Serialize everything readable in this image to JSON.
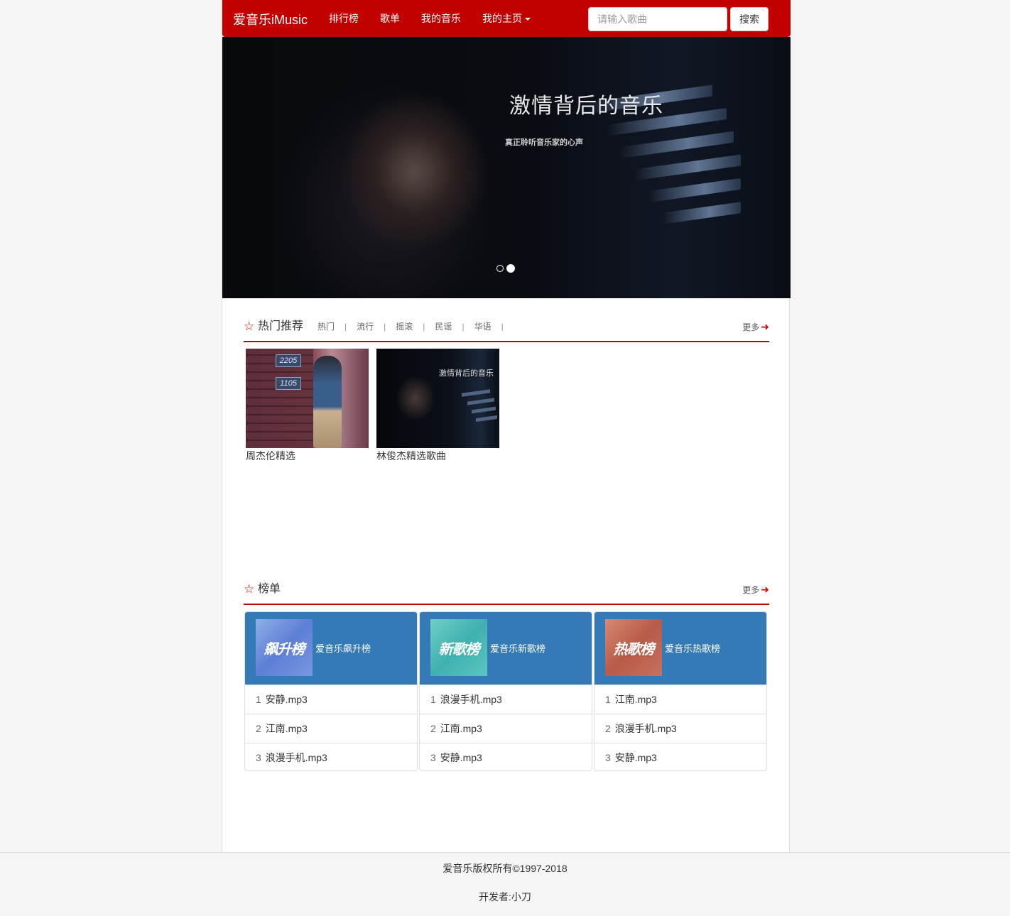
{
  "navbar": {
    "brand": "爱音乐iMusic",
    "items": [
      {
        "label": "排行榜"
      },
      {
        "label": "歌单"
      },
      {
        "label": "我的音乐"
      },
      {
        "label": "我的主页"
      }
    ],
    "search_placeholder": "请输入歌曲",
    "search_button": "搜索",
    "accent_color": "#c20000"
  },
  "banner": {
    "title": "激情背后的音乐",
    "subtitle": "真正聆听音乐家的心声",
    "slides": 2,
    "active_slide": 2
  },
  "hot": {
    "title": "热门推荐",
    "tags": [
      "热门",
      "流行",
      "摇滚",
      "民谣",
      "华语"
    ],
    "more": "更多",
    "albums": [
      {
        "caption": "周杰伦精选",
        "sign_top": "2205",
        "sign_bottom": "1105"
      },
      {
        "caption": "林俊杰精选歌曲",
        "cover_title": "激情背后的音乐"
      }
    ]
  },
  "charts": {
    "title": "榜单",
    "more": "更多",
    "header_color": "#337ab7",
    "lists": [
      {
        "logo": "飙升榜",
        "name": "爱音乐飙升榜",
        "rows": [
          {
            "rank": "1",
            "song": "安静.mp3"
          },
          {
            "rank": "2",
            "song": "江南.mp3"
          },
          {
            "rank": "3",
            "song": "浪漫手机.mp3"
          }
        ]
      },
      {
        "logo": "新歌榜",
        "name": "爱音乐新歌榜",
        "rows": [
          {
            "rank": "1",
            "song": "浪漫手机.mp3"
          },
          {
            "rank": "2",
            "song": "江南.mp3"
          },
          {
            "rank": "3",
            "song": "安静.mp3"
          }
        ]
      },
      {
        "logo": "热歌榜",
        "name": "爱音乐热歌榜",
        "rows": [
          {
            "rank": "1",
            "song": "江南.mp3"
          },
          {
            "rank": "2",
            "song": "浪漫手机.mp3"
          },
          {
            "rank": "3",
            "song": "安静.mp3"
          }
        ]
      }
    ]
  },
  "footer": {
    "copyright": "爱音乐版权所有©1997-2018",
    "developer": "开发者:小刀"
  }
}
